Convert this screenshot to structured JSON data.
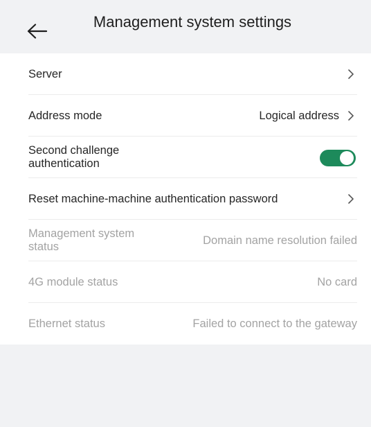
{
  "header": {
    "title": "Management system settings",
    "back_icon": "arrow-left-icon"
  },
  "rows": [
    {
      "label": "Server",
      "value": "",
      "icon": "chevron-right-icon"
    },
    {
      "label": "Address mode",
      "value": "Logical address",
      "icon": "chevron-right-icon"
    },
    {
      "label": "Second challenge authentication",
      "toggle_on": true
    },
    {
      "label": "Reset machine-machine authentication password",
      "value": "",
      "icon": "chevron-right-icon"
    },
    {
      "label": "Management system status",
      "value": "Domain name resolution failed"
    },
    {
      "label": "4G module status",
      "value": "No card"
    },
    {
      "label": "Ethernet status",
      "value": "Failed to connect to the gateway"
    }
  ],
  "colors": {
    "header_bg": "#f1f2f4",
    "toggle_on": "#1d8a5b",
    "status_text": "#a3a3a3"
  }
}
